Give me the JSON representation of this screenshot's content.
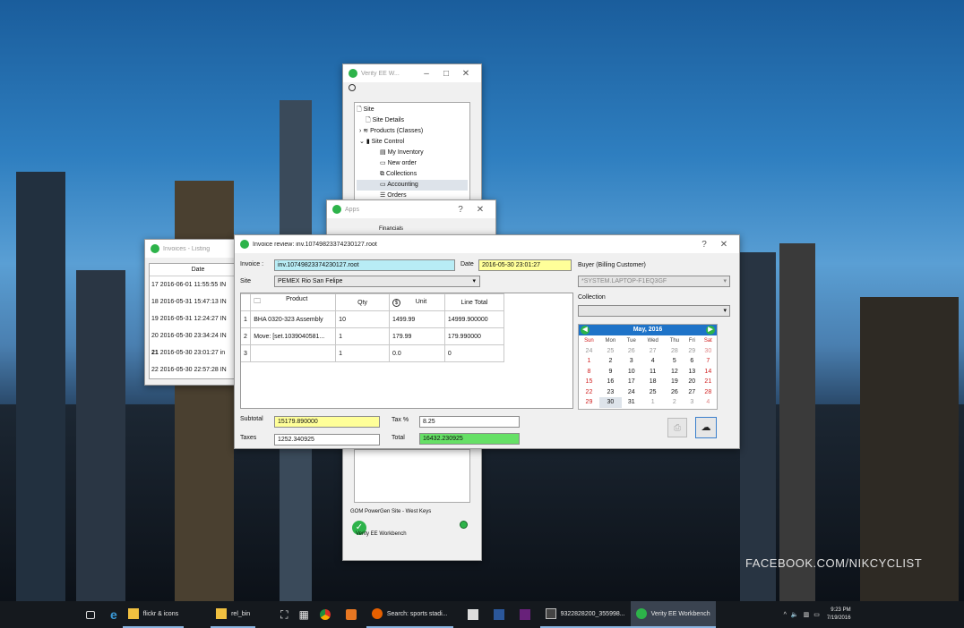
{
  "watermark": "FACEBOOK.COM/NIKCYCLIST",
  "verity_window": {
    "title": "Verity EE W...",
    "tree": [
      "Site",
      "Site Details",
      "Products (Classes)",
      "Site Control",
      "My Inventory",
      "New order",
      "Collections",
      "Accounting",
      "Orders"
    ],
    "site_name": "GOM PowerGen Site - West Keys",
    "footer_label": "Verity EE Workbench"
  },
  "apps_window": {
    "title": "Apps",
    "header": "Financials"
  },
  "listing_window": {
    "title": "Invoices - Listing",
    "column_header": "Date",
    "rows": [
      {
        "num": "17",
        "date": "2016-06-01 11:55:55",
        "tail": "IN"
      },
      {
        "num": "18",
        "date": "2016-05-31 15:47:13",
        "tail": "IN"
      },
      {
        "num": "19",
        "date": "2016-05-31 12:24:27",
        "tail": "IN"
      },
      {
        "num": "20",
        "date": "2016-05-30 23:34:24",
        "tail": "IN"
      },
      {
        "num": "21",
        "date": "2016-05-30 23:01:27",
        "tail": "in"
      },
      {
        "num": "22",
        "date": "2016-05-30 22:57:28",
        "tail": "IN"
      }
    ]
  },
  "invoice_window": {
    "title": "Invoice review: inv.10749823374230127.root",
    "invoice_label": "Invoice :",
    "invoice_value": "inv.10749823374230127.root",
    "date_label": "Date",
    "date_value": "2016-05-30 23:01:27",
    "site_label": "Site",
    "site_value": "PEMEX Rio San Felipe",
    "buyer_label": "Buyer (Billing Customer)",
    "buyer_value": "*SYSTEM.LAPTOP-F1EQ3GF",
    "collection_label": "Collection",
    "headers": {
      "product": "Product",
      "qty": "Qty",
      "unit": "Unit",
      "line_total": "Line Total"
    },
    "lines": [
      {
        "num": "1",
        "product": "BHA 0320-323 Assembly",
        "qty": "10",
        "unit": "1499.99",
        "total": "14999.900000"
      },
      {
        "num": "2",
        "product": "Move: [set.1039040581...",
        "qty": "1",
        "unit": "179.99",
        "total": "179.990000"
      },
      {
        "num": "3",
        "product": "",
        "qty": "1",
        "unit": "0.0",
        "total": "0"
      }
    ],
    "subtotal_label": "Subtotal",
    "subtotal_value": "15179.890000",
    "tax_pct_label": "Tax %",
    "tax_pct_value": "8.25",
    "taxes_label": "Taxes",
    "taxes_value": "1252.340925",
    "total_label": "Total",
    "total_value": "16432.230925",
    "help_label": "?",
    "close_label": "✕"
  },
  "calendar": {
    "month": "May,  2016",
    "day_headers": [
      "Sun",
      "Mon",
      "Tue",
      "Wed",
      "Thu",
      "Fri",
      "Sat"
    ],
    "weeks": [
      [
        "24",
        "25",
        "26",
        "27",
        "28",
        "29",
        "30"
      ],
      [
        "1",
        "2",
        "3",
        "4",
        "5",
        "6",
        "7"
      ],
      [
        "8",
        "9",
        "10",
        "11",
        "12",
        "13",
        "14"
      ],
      [
        "15",
        "16",
        "17",
        "18",
        "19",
        "20",
        "21"
      ],
      [
        "22",
        "23",
        "24",
        "25",
        "26",
        "27",
        "28"
      ],
      [
        "29",
        "30",
        "31",
        "1",
        "2",
        "3",
        "4"
      ]
    ]
  },
  "taskbar": {
    "items": [
      "flickr & icons",
      "rel_bin",
      "Search: sports stadi...",
      "9322828200_355998...",
      "Verity EE Workbench"
    ],
    "time": "9:23 PM",
    "date": "7/19/2016"
  },
  "colors": {
    "invoice_field": "#b8ecf5",
    "date_field": "#ffff99",
    "subtotal_field": "#ffff99",
    "total_field": "#66e066",
    "calendar_header": "#1e73c8"
  }
}
